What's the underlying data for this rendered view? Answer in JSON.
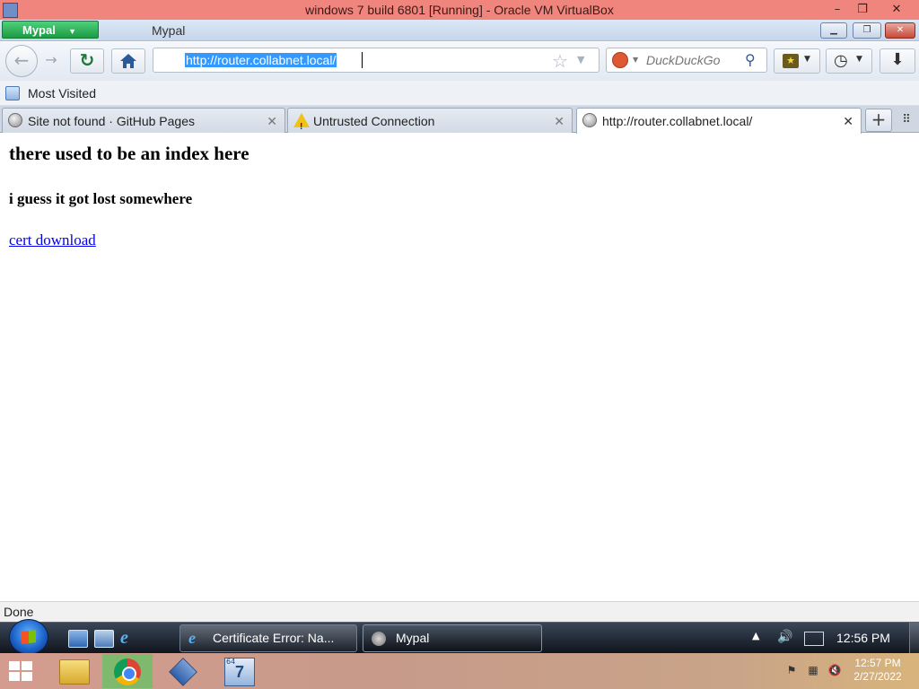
{
  "host_window": {
    "title": "windows 7 build 6801 [Running] - Oracle VM VirtualBox",
    "minimize_label": "–",
    "restore_label": "❐",
    "close_label": "✕"
  },
  "browser": {
    "app_button_label": "Mypal",
    "window_title": "Mypal",
    "url": "http://router.collabnet.local/",
    "search_placeholder": "DuckDuckGo",
    "bookmarks": [
      {
        "label": "Most Visited"
      }
    ],
    "tabs": [
      {
        "label": "Site not found · GitHub Pages",
        "icon": "globe-icon"
      },
      {
        "label": "Untrusted Connection",
        "icon": "warning-icon"
      },
      {
        "label": "http://router.collabnet.local/",
        "icon": "globe-icon",
        "active": true
      }
    ],
    "tab_close_glyph": "✕",
    "new_tab_glyph": "+",
    "status": "Done"
  },
  "page": {
    "heading": "there used to be an index here",
    "subheading": "i guess it got lost somewhere",
    "link_text": "cert download"
  },
  "guest_taskbar": {
    "windows": [
      {
        "label": "Certificate Error: Na...",
        "icon": "ie-icon"
      },
      {
        "label": "Mypal",
        "icon": "mypal-icon",
        "active": true
      }
    ],
    "time": "12:56 PM"
  },
  "host_taskbar": {
    "apps": [
      "file-explorer-icon",
      "chrome-icon",
      "virtualbox-icon",
      "win7-vm-icon"
    ],
    "time": "12:57 PM",
    "date": "2/27/2022",
    "vm_icon_badge": "64"
  },
  "colors": {
    "host_titlebar": "#f0857d",
    "link": "#0000ee",
    "url_selection": "#3399ff",
    "mypal_button": "#1c9b45"
  }
}
